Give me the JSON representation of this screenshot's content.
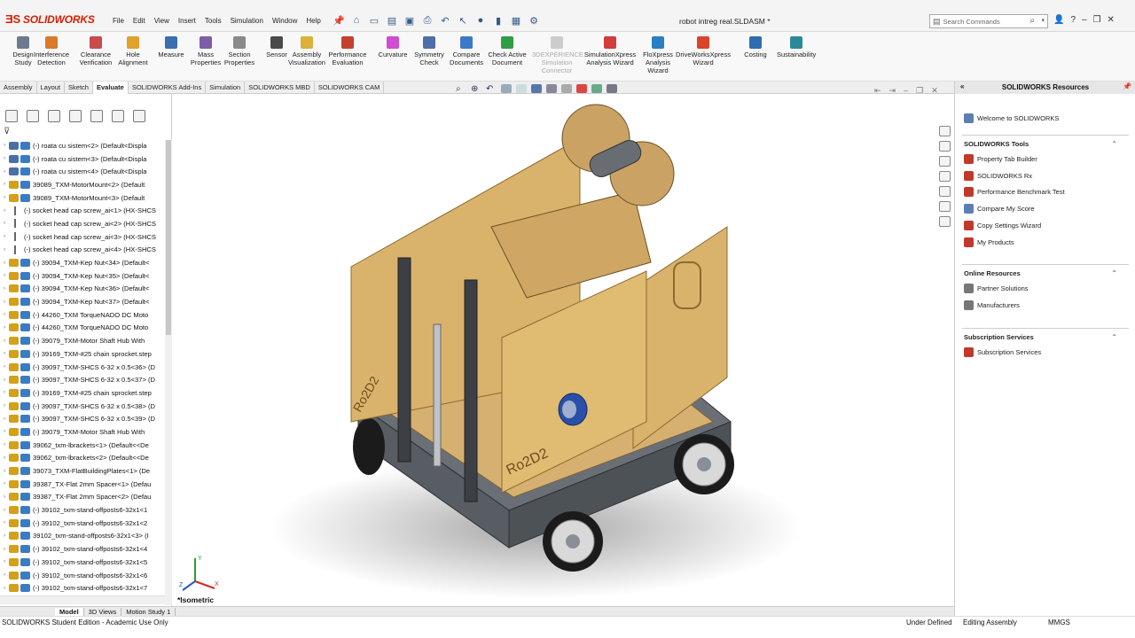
{
  "app": {
    "logo_text": "SOLIDWORKS",
    "document_title": "robot intreg real.SLDASM *",
    "menu": [
      "File",
      "Edit",
      "View",
      "Insert",
      "Tools",
      "Simulation",
      "Window",
      "Help"
    ],
    "search_placeholder": "Search Commands"
  },
  "ribbon": {
    "buttons": [
      {
        "label": "Design Study",
        "icon": "design-study-icon",
        "color": "#6b7a8f"
      },
      {
        "label": "Interference Detection",
        "icon": "interference-icon",
        "color": "#d97a2b"
      },
      {
        "label": "Clearance Verification",
        "icon": "clearance-icon",
        "color": "#c94b4b"
      },
      {
        "label": "Hole Alignment",
        "icon": "hole-alignment-icon",
        "color": "#e0a22b"
      },
      {
        "label": "Measure",
        "icon": "measure-icon",
        "color": "#3a6fb0"
      },
      {
        "label": "Mass Properties",
        "icon": "mass-properties-icon",
        "color": "#7b5ea7"
      },
      {
        "label": "Section Properties",
        "icon": "section-properties-icon",
        "color": "#8a8a8a"
      },
      {
        "label": "Sensor",
        "icon": "sensor-icon",
        "color": "#4a4a4a"
      },
      {
        "label": "Assembly Visualization",
        "icon": "assembly-visualization-icon",
        "color": "#d9b13b"
      },
      {
        "label": "Performance Evaluation",
        "icon": "performance-evaluation-icon",
        "color": "#c4402f"
      },
      {
        "label": "Curvature",
        "icon": "curvature-icon",
        "color": "#d24bd0"
      },
      {
        "label": "Symmetry Check",
        "icon": "symmetry-check-icon",
        "color": "#4e6fa8"
      },
      {
        "label": "Compare Documents",
        "icon": "compare-documents-icon",
        "color": "#3c78c8"
      },
      {
        "label": "Check Active Document",
        "icon": "check-document-icon",
        "color": "#2f9e44"
      },
      {
        "label": "3DEXPERIENCE Simulation Connector",
        "icon": "simulation-connector-icon",
        "color": "#cccccc",
        "disabled": true
      },
      {
        "label": "SimulationXpress Analysis Wizard",
        "icon": "simulationxpress-icon",
        "color": "#cf3d3d"
      },
      {
        "label": "FloXpress Analysis Wizard",
        "icon": "floxpress-icon",
        "color": "#2a7fc1"
      },
      {
        "label": "DriveWorksXpress Wizard",
        "icon": "driveworksxpress-icon",
        "color": "#d9442b"
      },
      {
        "label": "Costing",
        "icon": "costing-icon",
        "color": "#2e6db0"
      },
      {
        "label": "Sustainability",
        "icon": "sustainability-icon",
        "color": "#2a8a9a"
      }
    ]
  },
  "tabs": [
    {
      "label": "Assembly"
    },
    {
      "label": "Layout"
    },
    {
      "label": "Sketch"
    },
    {
      "label": "Evaluate",
      "active": true
    },
    {
      "label": "SOLIDWORKS Add-Ins"
    },
    {
      "label": "Simulation"
    },
    {
      "label": "SOLIDWORKS MBD"
    },
    {
      "label": "SOLIDWORKS CAM"
    }
  ],
  "tree": {
    "items": [
      {
        "label": "(-) roata cu sistem<2> (Default<Displa",
        "kind": "asm"
      },
      {
        "label": "(-) roata cu sistem<3> (Default<Displa",
        "kind": "asm"
      },
      {
        "label": "(-) roata cu sistem<4> (Default<Displa",
        "kind": "asm"
      },
      {
        "label": "39089_TXM-MotorMount<2> (Default",
        "kind": "part"
      },
      {
        "label": "39089_TXM-MotorMount<3> (Default",
        "kind": "part"
      },
      {
        "label": "(-) socket head cap screw_ai<1> (HX-SHCS",
        "kind": "screw"
      },
      {
        "label": "(-) socket head cap screw_ai<2> (HX-SHCS",
        "kind": "screw"
      },
      {
        "label": "(-) socket head cap screw_ai<3> (HX-SHCS",
        "kind": "screw"
      },
      {
        "label": "(-) socket head cap screw_ai<4> (HX-SHCS",
        "kind": "screw"
      },
      {
        "label": "(-) 39094_TXM-Kep Nut<34> (Default<",
        "kind": "part"
      },
      {
        "label": "(-) 39094_TXM-Kep Nut<35> (Default<",
        "kind": "part"
      },
      {
        "label": "(-) 39094_TXM-Kep Nut<36> (Default<",
        "kind": "part"
      },
      {
        "label": "(-) 39094_TXM-Kep Nut<37> (Default<",
        "kind": "part"
      },
      {
        "label": "(-) 44260_TXM TorqueNADO DC Moto",
        "kind": "part"
      },
      {
        "label": "(-) 44260_TXM TorqueNADO DC Moto",
        "kind": "part"
      },
      {
        "label": "(-) 39079_TXM-Motor Shaft Hub With",
        "kind": "part"
      },
      {
        "label": "(-) 39169_TXM-#25 chain sprocket.step",
        "kind": "part"
      },
      {
        "label": "(-) 39097_TXM-SHCS 6-32 x 0.5<36> (D",
        "kind": "part"
      },
      {
        "label": "(-) 39097_TXM-SHCS 6-32 x 0.5<37> (D",
        "kind": "part"
      },
      {
        "label": "(-) 39169_TXM-#25 chain sprocket.step",
        "kind": "part"
      },
      {
        "label": "(-) 39097_TXM-SHCS 6-32 x 0.5<38> (D",
        "kind": "part"
      },
      {
        "label": "(-) 39097_TXM-SHCS 6-32 x 0.5<39> (D",
        "kind": "part"
      },
      {
        "label": "(-) 39079_TXM-Motor Shaft Hub With",
        "kind": "part"
      },
      {
        "label": "39062_txm-lbrackets<1> (Default<<De",
        "kind": "part"
      },
      {
        "label": "39062_txm-lbrackets<2> (Default<<De",
        "kind": "part"
      },
      {
        "label": "39073_TXM-FlatBuildingPlates<1> (De",
        "kind": "part"
      },
      {
        "label": "39387_TX-Flat 2mm Spacer<1> (Defau",
        "kind": "part"
      },
      {
        "label": "39387_TX-Flat 2mm Spacer<2> (Defau",
        "kind": "part"
      },
      {
        "label": "(-) 39102_txm-stand-offposts6-32x1<1",
        "kind": "part"
      },
      {
        "label": "(-) 39102_txm-stand-offposts6-32x1<2",
        "kind": "part"
      },
      {
        "label": "39102_txm-stand-offposts6-32x1<3> (I",
        "kind": "part"
      },
      {
        "label": "(-) 39102_txm-stand-offposts6-32x1<4",
        "kind": "part"
      },
      {
        "label": "(-) 39102_txm-stand-offposts6-32x1<5",
        "kind": "part"
      },
      {
        "label": "(-) 39102_txm-stand-offposts6-32x1<6",
        "kind": "part"
      },
      {
        "label": "(-) 39102_txm-stand-offposts6-32x1<7",
        "kind": "part"
      }
    ]
  },
  "viewport": {
    "view_label": "*Isometric",
    "axis_labels": {
      "x": "X",
      "y": "Y",
      "z": "Z"
    },
    "panel_text_1": "Ro2D2",
    "panel_text_2": "Ro2D2"
  },
  "bottom_tabs": [
    {
      "label": "Model",
      "active": true
    },
    {
      "label": "3D Views"
    },
    {
      "label": "Motion Study 1"
    }
  ],
  "status": {
    "edition": "SOLIDWORKS Student Edition - Academic Use Only",
    "definition": "Under Defined",
    "mode": "Editing Assembly",
    "units": "MMGS"
  },
  "resources": {
    "title": "SOLIDWORKS Resources",
    "welcome": "Welcome to SOLIDWORKS",
    "sections": [
      {
        "title": "SOLIDWORKS Tools",
        "items": [
          {
            "label": "Property Tab Builder",
            "color": "#c0392b"
          },
          {
            "label": "SOLIDWORKS Rx",
            "color": "#c0392b"
          },
          {
            "label": "Performance Benchmark Test",
            "color": "#c0392b"
          },
          {
            "label": "Compare My Score",
            "color": "#5a7fb5"
          },
          {
            "label": "Copy Settings Wizard",
            "color": "#c0392b"
          },
          {
            "label": "My Products",
            "color": "#c0392b"
          }
        ]
      },
      {
        "title": "Online Resources",
        "items": [
          {
            "label": "Partner Solutions",
            "color": "#777777"
          },
          {
            "label": "Manufacturers",
            "color": "#777777"
          }
        ]
      },
      {
        "title": "Subscription Services",
        "items": [
          {
            "label": "Subscription Services",
            "color": "#c0392b"
          }
        ]
      }
    ]
  },
  "colors": {
    "brand_red": "#d81e05",
    "wood_panel": "#d9b36b",
    "metal_dark": "#555a60",
    "motor_blue": "#2b4fa8"
  }
}
